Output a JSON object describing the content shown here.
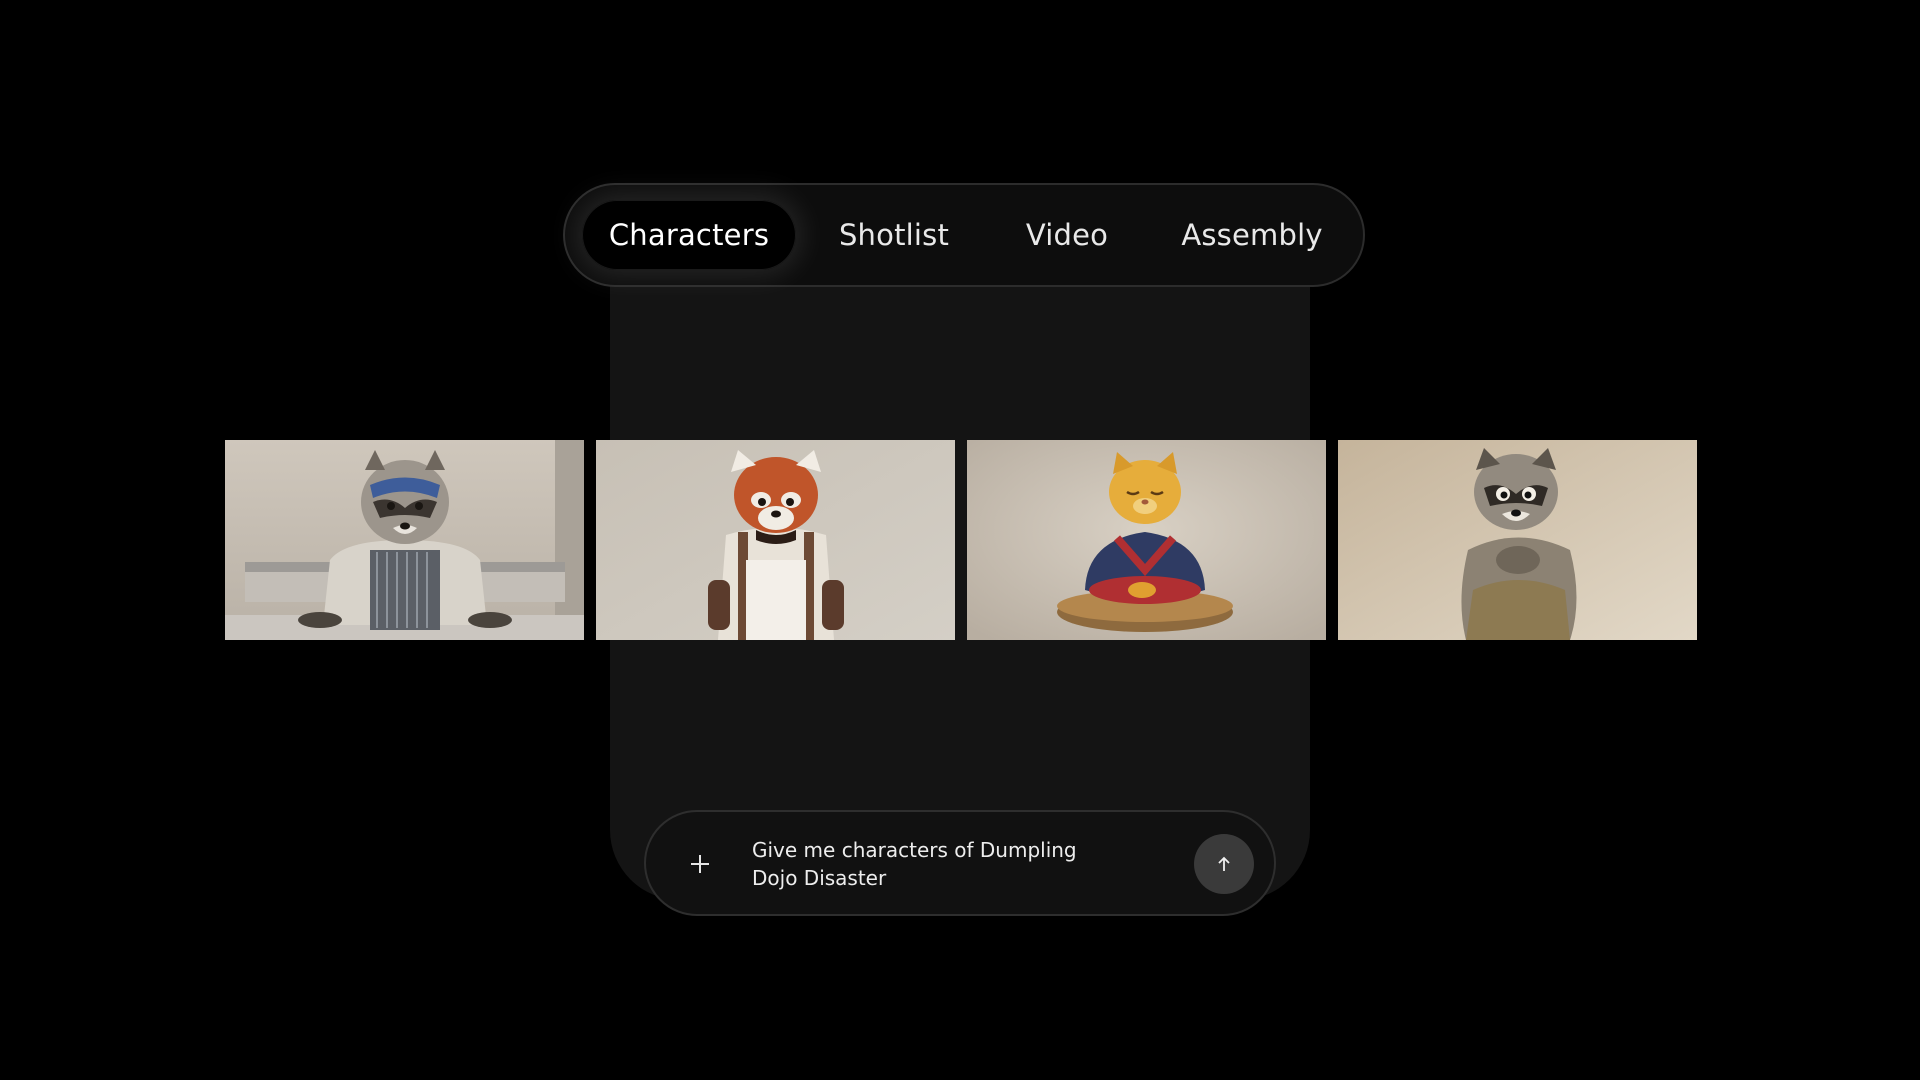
{
  "tabs": [
    {
      "label": "Characters",
      "active": true
    },
    {
      "label": "Shotlist",
      "active": false
    },
    {
      "label": "Video",
      "active": false
    },
    {
      "label": "Assembly",
      "active": false
    }
  ],
  "characters": [
    {
      "name": "raccoon-chef-icon"
    },
    {
      "name": "red-panda-chef-icon"
    },
    {
      "name": "meditating-cat-icon"
    },
    {
      "name": "raccoon-standing-icon"
    }
  ],
  "prompt": {
    "text": "Give me characters of Dumpling Dojo Disaster"
  },
  "colors": {
    "background": "#000000",
    "panel": "#141414",
    "send_button": "#3a3a3a"
  }
}
